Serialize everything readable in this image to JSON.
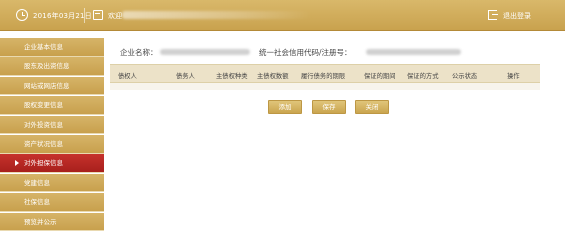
{
  "topbar": {
    "date": "2016年03月21日",
    "user_label": "欢迎",
    "exit_label": "退出登录"
  },
  "sidebar": {
    "items": [
      {
        "label": "企业基本信息",
        "active": false
      },
      {
        "label": "股东及出资信息",
        "active": false
      },
      {
        "label": "网站或网店信息",
        "active": false
      },
      {
        "label": "股权变更信息",
        "active": false
      },
      {
        "label": "对外投资信息",
        "active": false
      },
      {
        "label": "资产状况信息",
        "active": false
      },
      {
        "label": "对外担保信息",
        "active": true
      },
      {
        "label": "党建信息",
        "active": false
      },
      {
        "label": "社保信息",
        "active": false
      },
      {
        "label": "预览并公示",
        "active": false
      }
    ]
  },
  "main": {
    "company_name_label": "企业名称：",
    "uscc_label": "统一社会信用代码/注册号：",
    "columns": [
      "债权人",
      "债务人",
      "主债权种类",
      "主债权数额",
      "履行债务的期限",
      "保证的期间",
      "保证的方式",
      "公示状态",
      "操作"
    ],
    "buttons": {
      "add": "添加",
      "save": "保存",
      "close": "关闭"
    }
  },
  "colors": {
    "gold": "#c9a24e",
    "active_red": "#b8261f",
    "header_bg": "#ece2c8"
  }
}
